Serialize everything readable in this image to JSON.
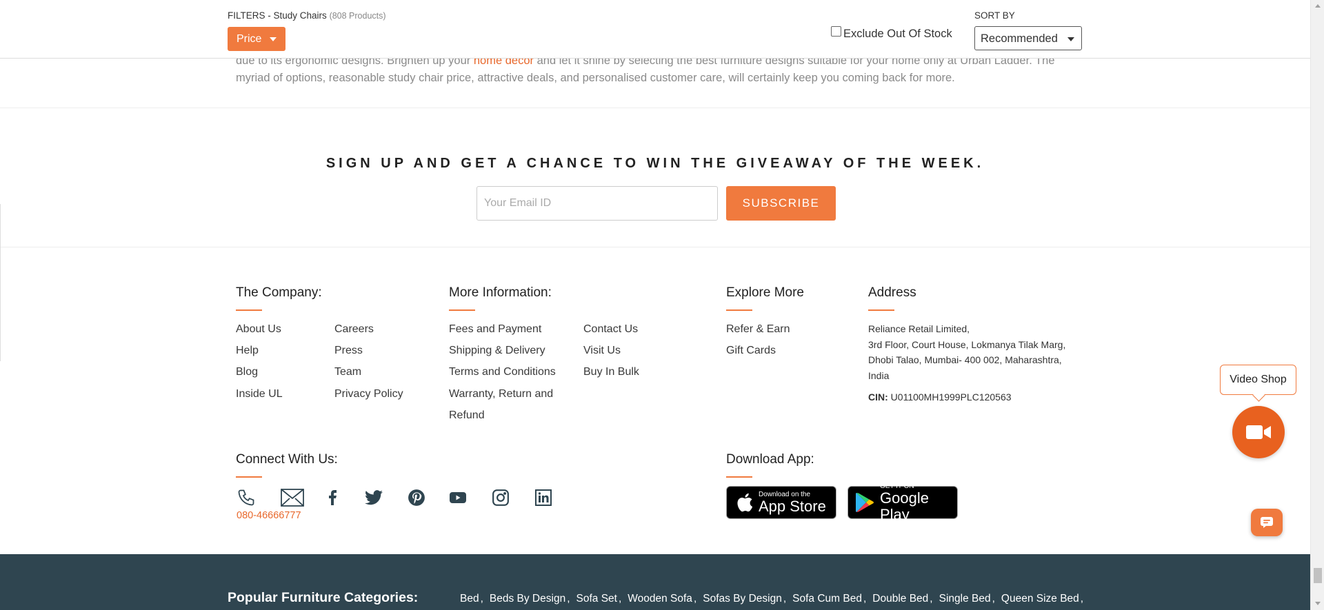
{
  "intro": {
    "text_before": "due to its ergonomic designs. Brighten up your ",
    "link": "home décor",
    "text_after": " and let it shine by selecting the best furniture designs suitable for your home only at Urban Ladder. The myriad of options, reasonable study chair price, attractive deals, and personalised customer care, will certainly keep you coming back for more."
  },
  "filters": {
    "title": "FILTERS - Study Chairs",
    "count": "(808 Products)",
    "price_label": "Price",
    "exclude_label": "Exclude Out Of Stock",
    "exclude_checked": false,
    "sort_label": "SORT BY",
    "sort_value": "Recommended"
  },
  "newsletter": {
    "title": "SIGN UP AND GET A CHANCE TO WIN THE GIVEAWAY OF THE WEEK.",
    "placeholder": "Your Email ID",
    "button": "SUBSCRIBE"
  },
  "company": {
    "heading": "The Company:",
    "col1": [
      "About Us",
      "Help",
      "Blog",
      "Inside UL"
    ],
    "col2": [
      "Careers",
      "Press",
      "Team",
      "Privacy Policy"
    ]
  },
  "more_info": {
    "heading": "More Information:",
    "col1": [
      "Fees and Payment",
      "Shipping & Delivery",
      "Terms and Conditions",
      "Warranty, Return and",
      "Refund"
    ],
    "col2": [
      "Contact Us",
      "Visit Us",
      "Buy In Bulk"
    ]
  },
  "explore": {
    "heading": "Explore More",
    "items": [
      "Refer & Earn",
      "Gift Cards"
    ]
  },
  "address": {
    "heading": "Address",
    "lines": [
      "Reliance Retail Limited,",
      "3rd Floor, Court House, Lokmanya Tilak Marg,",
      "Dhobi Talao, Mumbai- 400 002, Maharashtra,",
      "India"
    ],
    "cin_label": "CIN:",
    "cin_value": " U01100MH1999PLC120563"
  },
  "connect": {
    "heading": "Connect With Us:",
    "phone": "080-46666777",
    "icons": [
      "phone-icon",
      "mail-icon",
      "facebook-icon",
      "twitter-icon",
      "pinterest-icon",
      "youtube-icon",
      "instagram-icon",
      "linkedin-icon"
    ]
  },
  "download": {
    "heading": "Download App:",
    "appstore_small": "Download on the",
    "appstore_big": "App Store",
    "googleplay_small": "GET IT ON",
    "googleplay_big": "Google Play"
  },
  "video_shop": {
    "label": "Video Shop"
  },
  "popular": {
    "heading": "Popular Furniture Categories:",
    "items": [
      "Bed",
      "Beds By Design",
      "Sofa Set",
      "Wooden Sofa",
      "Sofas By Design",
      "Sofa Cum Bed",
      "Double Bed",
      "Single Bed",
      "Queen Size Bed"
    ]
  },
  "colors": {
    "accent": "#f07a3e",
    "dark_band": "#2f4550",
    "link": "#e8682c"
  }
}
